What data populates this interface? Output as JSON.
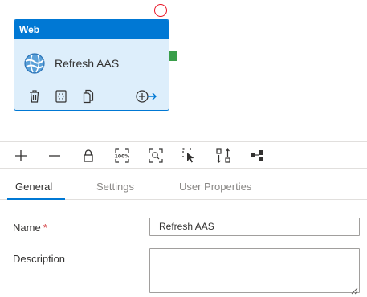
{
  "canvas": {
    "activity": {
      "type_label": "Web",
      "name": "Refresh AAS"
    }
  },
  "icons": {
    "activity": "globe-icon",
    "delete": "trash-icon",
    "code": "code-icon",
    "copy": "copy-icon",
    "add_output": "add-arrow-icon",
    "toolbar": [
      "plus-icon",
      "minus-icon",
      "lock-icon",
      "zoom-100-icon",
      "zoom-fit-icon",
      "select-icon",
      "auto-align-icon",
      "layout-icon"
    ]
  },
  "tabs": [
    {
      "label": "General"
    },
    {
      "label": "Settings"
    },
    {
      "label": "User Properties"
    }
  ],
  "form": {
    "name_label": "Name",
    "required_mark": "*",
    "name_value": "Refresh AAS",
    "description_label": "Description",
    "description_value": ""
  },
  "colors": {
    "accent": "#0078d4",
    "activity_bg": "#ddeefb",
    "success": "#3a9e4a",
    "error": "#e81123"
  }
}
